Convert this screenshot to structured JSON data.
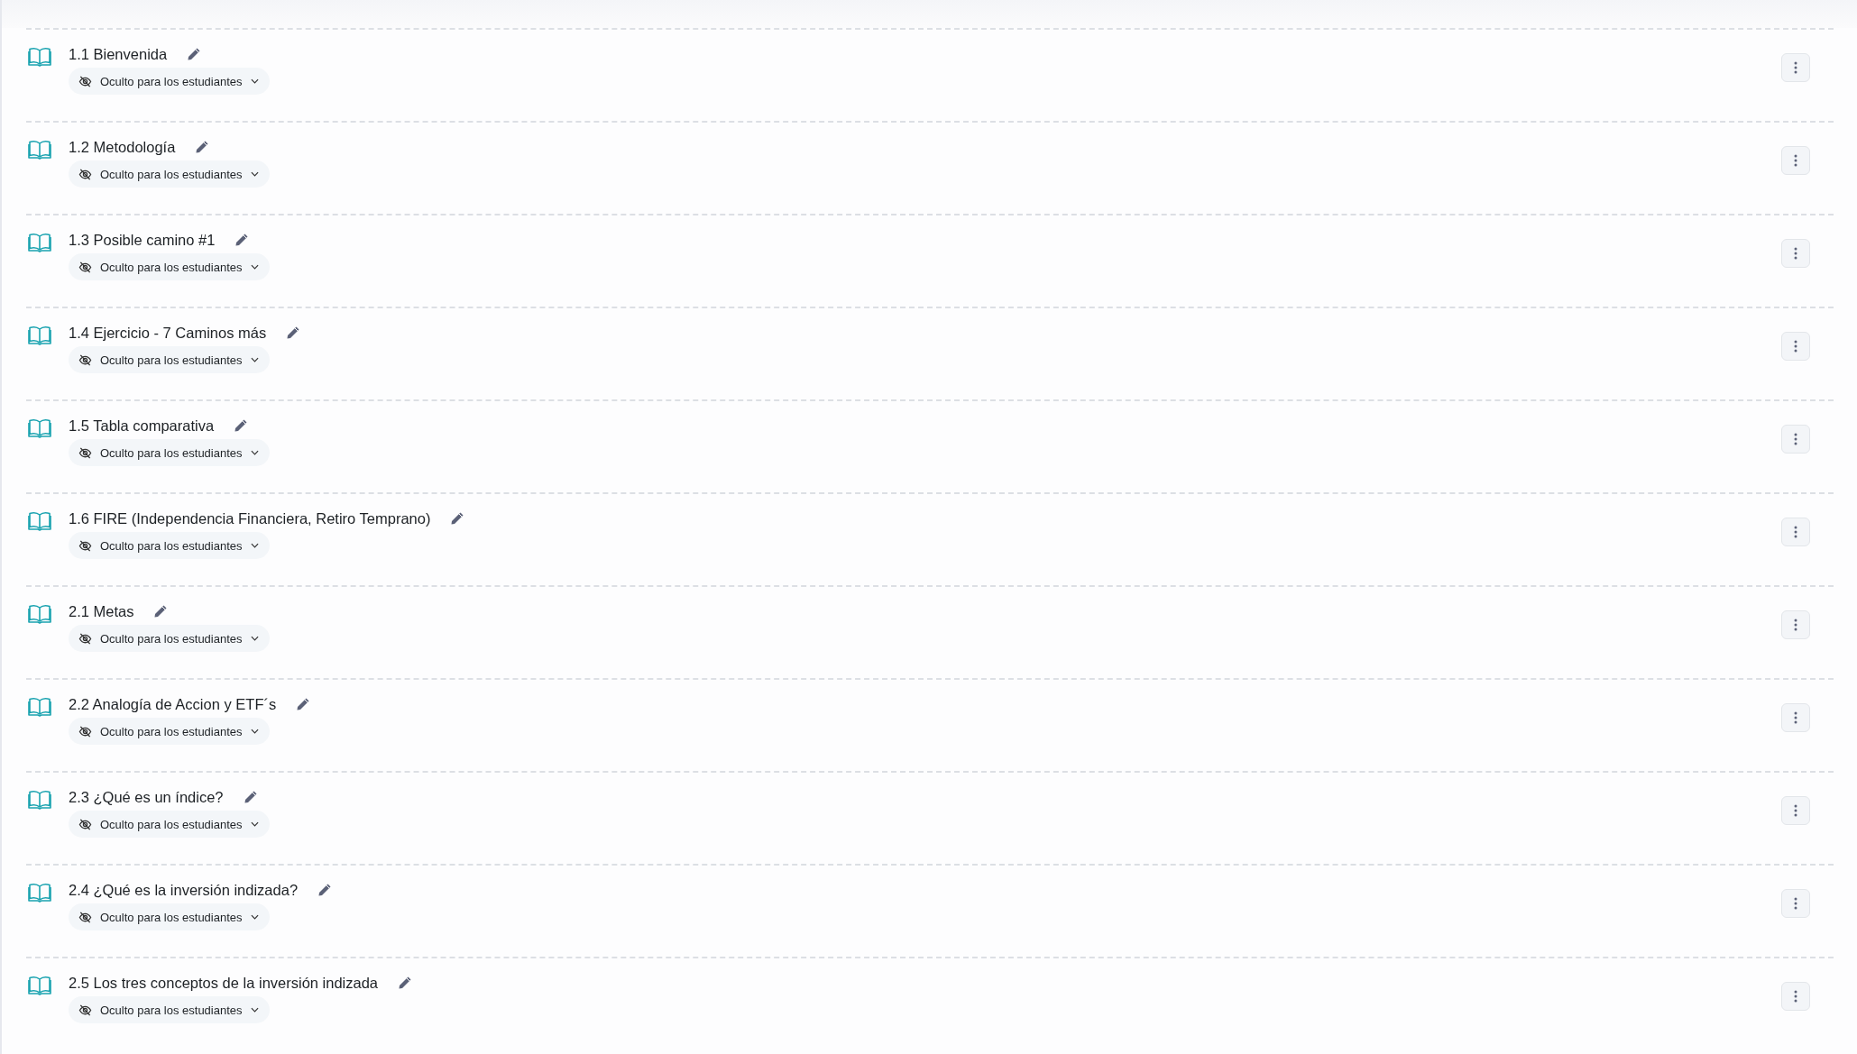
{
  "items": [
    {
      "title": "1.1 Bienvenida",
      "visibility": "Oculto para los estudiantes"
    },
    {
      "title": "1.2 Metodología",
      "visibility": "Oculto para los estudiantes"
    },
    {
      "title": "1.3 Posible camino #1",
      "visibility": "Oculto para los estudiantes"
    },
    {
      "title": "1.4 Ejercicio - 7 Caminos más",
      "visibility": "Oculto para los estudiantes"
    },
    {
      "title": "1.5 Tabla comparativa",
      "visibility": "Oculto para los estudiantes"
    },
    {
      "title": "1.6 FIRE (Independencia Financiera, Retiro Temprano)",
      "visibility": "Oculto para los estudiantes"
    },
    {
      "title": "2.1 Metas",
      "visibility": "Oculto para los estudiantes"
    },
    {
      "title": "2.2 Analogía de Accion y ETF´s",
      "visibility": "Oculto para los estudiantes"
    },
    {
      "title": "2.3 ¿Qué es un índice?",
      "visibility": "Oculto para los estudiantes"
    },
    {
      "title": "2.4 ¿Qué es la inversión indizada?",
      "visibility": "Oculto para los estudiantes"
    },
    {
      "title": "2.5 Los tres conceptos de la inversión indizada",
      "visibility": "Oculto para los estudiantes"
    }
  ]
}
